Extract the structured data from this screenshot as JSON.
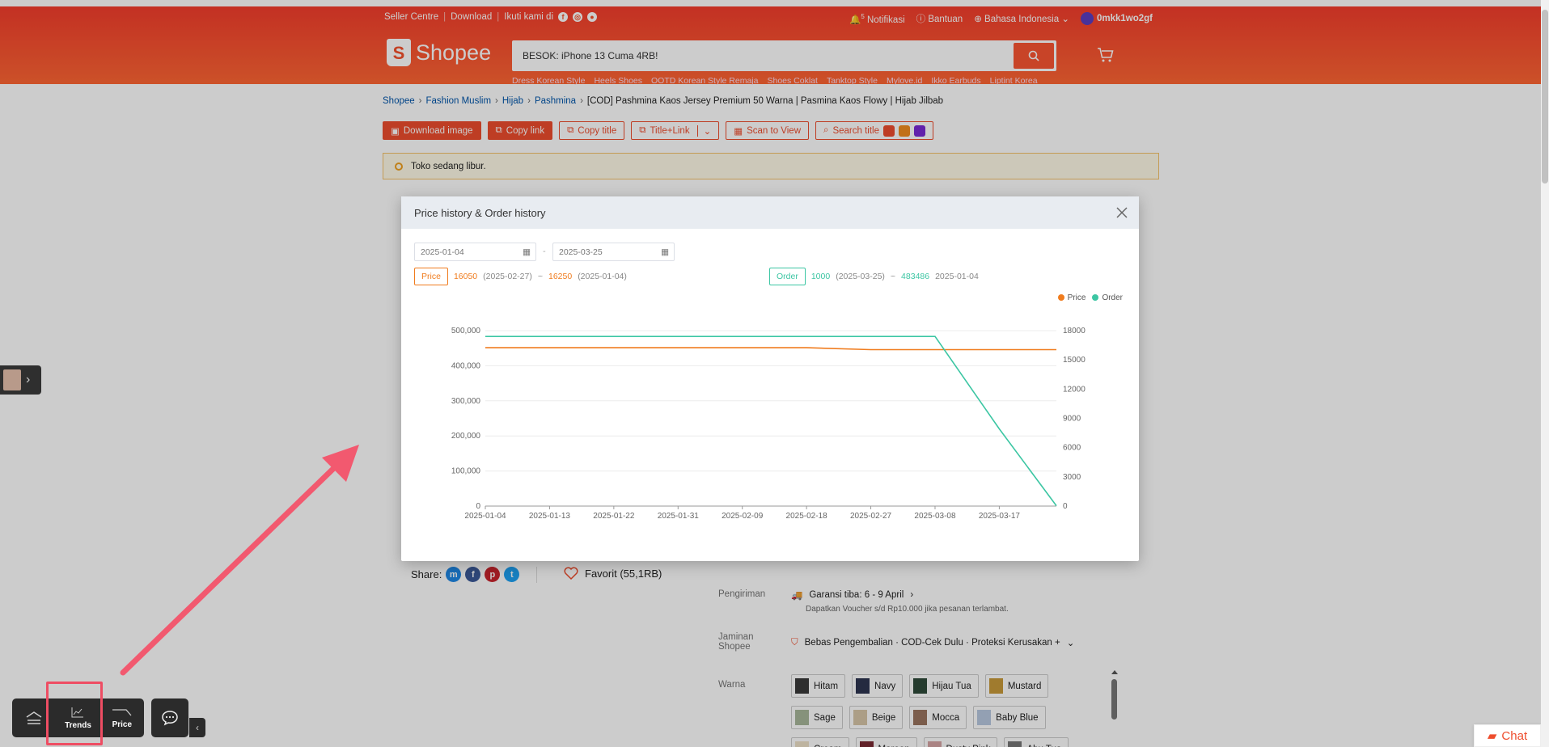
{
  "header": {
    "seller_centre": "Seller Centre",
    "download": "Download",
    "follow": "Ikuti kami di",
    "notifications": "Notifikasi",
    "notification_count": "5",
    "help": "Bantuan",
    "language": "Bahasa Indonesia",
    "username": "0mkk1wo2gf",
    "brand": "Shopee",
    "search_text": "BESOK: iPhone 13 Cuma 4RB!",
    "hotwords": [
      "Dress Korean Style",
      "Heels Shoes",
      "OOTD Korean Style Remaja",
      "Shoes Coklat",
      "Tanktop Style",
      "Mylove.id",
      "Ikko Earbuds",
      "Liptint Korea"
    ]
  },
  "breadcrumb": [
    "Shopee",
    "Fashion Muslim",
    "Hijab",
    "Pashmina"
  ],
  "breadcrumb_current": "[COD] Pashmina Kaos Jersey Premium 50 Warna | Pasmina Kaos Flowy | Hijab Jilbab",
  "toolbar": {
    "download_image": "Download image",
    "copy_link": "Copy link",
    "copy_title": "Copy title",
    "title_link": "Title+Link",
    "scan_to_view": "Scan to View",
    "search_title": "Search title"
  },
  "notice": "Toko sedang libur.",
  "share_label": "Share:",
  "favorite": "Favorit (55,1RB)",
  "shipping": {
    "label": "Pengiriman",
    "title": "Garansi tiba: 6 - 9 April",
    "sub": "Dapatkan Voucher s/d Rp10.000 jika pesanan terlambat."
  },
  "guarantee": {
    "label": "Jaminan Shopee",
    "text": "Bebas Pengembalian · COD-Cek Dulu · Proteksi Kerusakan +"
  },
  "variant_label": "Warna",
  "variants": [
    "Hitam",
    "Navy",
    "Hijau Tua",
    "Mustard",
    "Sage",
    "Beige",
    "Mocca",
    "Baby Blue",
    "Cream",
    "Maroon",
    "Dusty Pink",
    "Abu Tua"
  ],
  "modal": {
    "title": "Price history & Order history",
    "date_from": "2025-01-04",
    "date_to": "2025-03-25",
    "date_sep": "-",
    "price_tag": "Price",
    "price_min": "16050",
    "price_min_date": "(2025-02-27)",
    "price_max": "16250",
    "price_max_date": "(2025-01-04)",
    "order_tag": "Order",
    "order_min": "1000",
    "order_min_date": "(2025-03-25)",
    "order_max": "483486",
    "order_max_date": "2025-01-04",
    "range_sep": "~"
  },
  "colors": {
    "brand": "#ee4d2d",
    "price_line": "#f07c1e",
    "order_line": "#3cc6a3"
  },
  "chart_data": {
    "type": "line",
    "x": [
      "2025-01-04",
      "2025-01-13",
      "2025-01-22",
      "2025-01-31",
      "2025-02-09",
      "2025-02-18",
      "2025-02-27",
      "2025-03-08",
      "2025-03-17",
      "2025-03-25"
    ],
    "x_tick_labels": [
      "2025-01-04",
      "2025-01-13",
      "2025-01-22",
      "2025-01-31",
      "2025-02-09",
      "2025-02-18",
      "2025-02-27",
      "2025-03-08",
      "2025-03-17"
    ],
    "series": [
      {
        "name": "Price",
        "axis": "right",
        "color": "#f07c1e",
        "values": [
          16250,
          16250,
          16250,
          16250,
          16250,
          16250,
          16050,
          16050,
          16050,
          16050
        ]
      },
      {
        "name": "Order",
        "axis": "left",
        "color": "#3cc6a3",
        "values": [
          483486,
          483486,
          483486,
          483486,
          483486,
          483486,
          483486,
          483486,
          220000,
          1000
        ]
      }
    ],
    "left_axis": {
      "ticks": [
        0,
        100000,
        200000,
        300000,
        400000,
        500000
      ],
      "tick_labels": [
        "0",
        "100,000",
        "200,000",
        "300,000",
        "400,000",
        "500,000"
      ],
      "ylim": [
        0,
        500000
      ]
    },
    "right_axis": {
      "ticks": [
        0,
        3000,
        6000,
        9000,
        12000,
        15000,
        18000
      ],
      "tick_labels": [
        "0",
        "3000",
        "6000",
        "9000",
        "12000",
        "15000",
        "18000"
      ],
      "ylim": [
        0,
        18000
      ]
    },
    "legend": [
      "Price",
      "Order"
    ],
    "legend_position": "top-right",
    "grid": true
  },
  "bottom_bar": {
    "trends": "Trends",
    "price": "Price"
  },
  "chat_label": "Chat"
}
